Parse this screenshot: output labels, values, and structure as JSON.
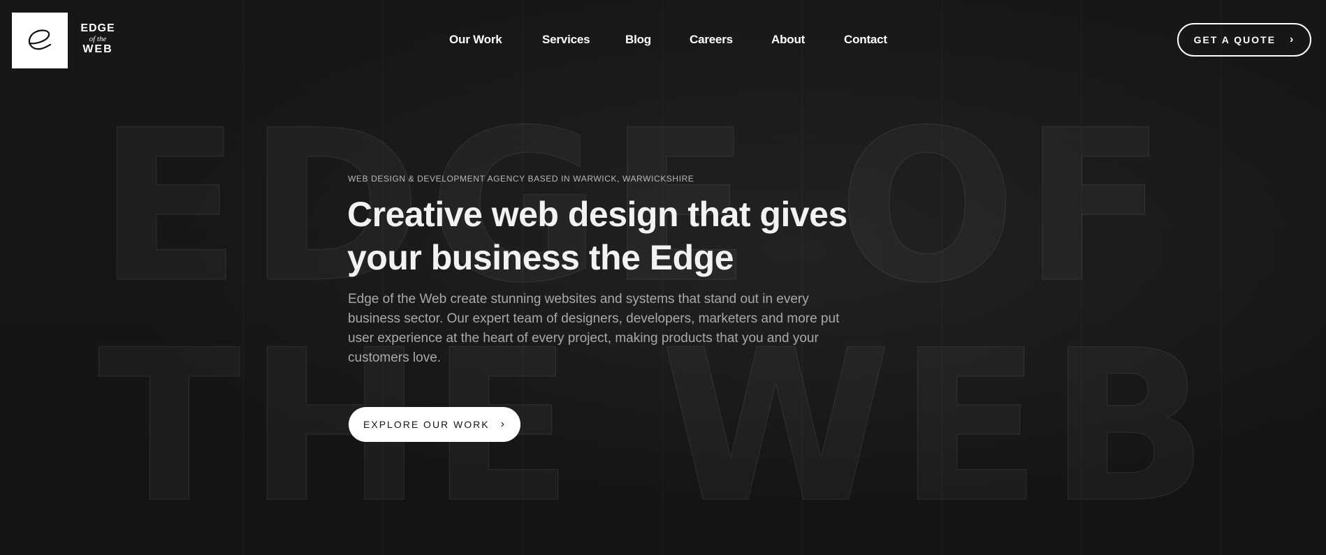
{
  "brand": {
    "logo_line1": "EDGE",
    "logo_line2": "of the",
    "logo_line3": "WEB",
    "logo_icon": "script-e-icon"
  },
  "nav": {
    "items": [
      {
        "label": "Our Work"
      },
      {
        "label": "Services"
      },
      {
        "label": "Blog"
      },
      {
        "label": "Careers"
      },
      {
        "label": "About"
      },
      {
        "label": "Contact"
      }
    ]
  },
  "header": {
    "quote_label": "GET A QUOTE",
    "quote_icon": "chevron-right-icon"
  },
  "hero": {
    "eyebrow": "WEB DESIGN & DEVELOPMENT AGENCY BASED IN WARWICK, WARWICKSHIRE",
    "headline_line1": "Creative web design that gives",
    "headline_line2": "your business the Edge",
    "body": "Edge of the Web create stunning websites and systems that stand out in every business sector. Our expert team of designers, developers, marketers and more put user experience at the heart of every project, making products that you and your customers love.",
    "cta_label": "EXPLORE OUR WORK",
    "cta_icon": "chevron-right-icon",
    "background_lettering": [
      "EDGE OF",
      "THE WEB"
    ]
  },
  "colors": {
    "background": "#151515",
    "text_primary": "#f2f2f2",
    "text_muted": "#a9a9a9",
    "button_bg": "#ffffff"
  }
}
